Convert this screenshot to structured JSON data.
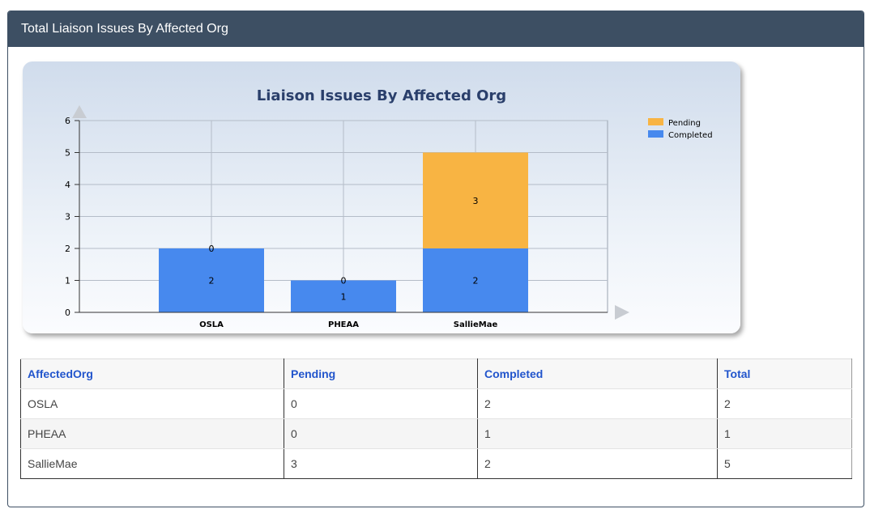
{
  "panel": {
    "title": "Total Liaison Issues By Affected Org"
  },
  "colors": {
    "header_bg": "#3d4f63",
    "pending": "#f8b443",
    "completed": "#4789ee",
    "link": "#2255cc"
  },
  "chart_data": {
    "type": "bar",
    "stacked": true,
    "title": "Liaison Issues By Affected Org",
    "xlabel": "",
    "ylabel": "",
    "categories": [
      "OSLA",
      "PHEAA",
      "SallieMae"
    ],
    "series": [
      {
        "name": "Completed",
        "values": [
          2,
          1,
          2
        ],
        "color": "#4789ee"
      },
      {
        "name": "Pending",
        "values": [
          0,
          0,
          3
        ],
        "color": "#f8b443"
      }
    ],
    "ylim": [
      0,
      6
    ],
    "yticks": [
      "0",
      "1",
      "2",
      "3",
      "4",
      "5",
      "6"
    ],
    "grid": true,
    "legend_position": "top-right",
    "legend": [
      "Pending",
      "Completed"
    ]
  },
  "table": {
    "headers": [
      "AffectedOrg",
      "Pending",
      "Completed",
      "Total"
    ],
    "rows": [
      [
        "OSLA",
        "0",
        "2",
        "2"
      ],
      [
        "PHEAA",
        "0",
        "1",
        "1"
      ],
      [
        "SallieMae",
        "3",
        "2",
        "5"
      ]
    ]
  }
}
